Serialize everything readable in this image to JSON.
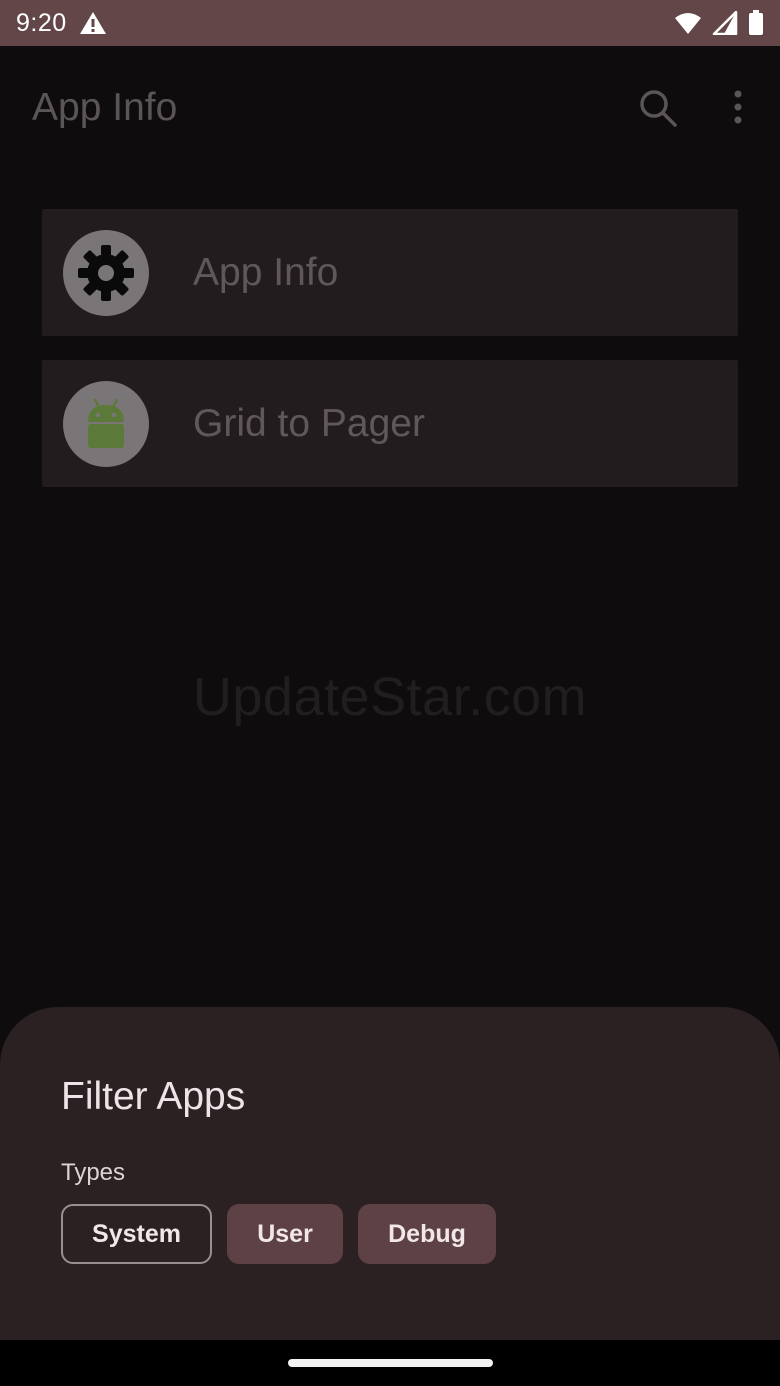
{
  "status_bar": {
    "time": "9:20",
    "icons": [
      "warning-icon",
      "wifi-icon",
      "signal-icon",
      "battery-icon"
    ]
  },
  "toolbar": {
    "title": "App Info",
    "icons": [
      "search-icon",
      "more-vert-icon"
    ]
  },
  "apps": [
    {
      "name": "App Info",
      "icon": "gear-icon"
    },
    {
      "name": "Grid to Pager",
      "icon": "android-icon"
    }
  ],
  "watermark": "UpdateStar.com",
  "filter_sheet": {
    "title": "Filter Apps",
    "types_label": "Types",
    "chips": [
      {
        "label": "System",
        "style": "outlined"
      },
      {
        "label": "User",
        "style": "filled"
      },
      {
        "label": "Debug",
        "style": "filled"
      }
    ]
  },
  "colors": {
    "status_bar": "#634748",
    "sheet_background": "#2b2123",
    "chip_filled": "#5e4145",
    "android_green": "#5b7a3a"
  }
}
